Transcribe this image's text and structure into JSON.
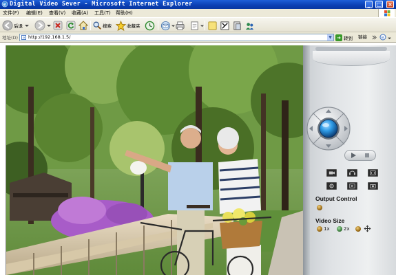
{
  "window": {
    "title": "Digital Video Sever - Microsoft Internet Explorer",
    "buttons": {
      "minimize": "_",
      "maximize": "□",
      "close": "×"
    }
  },
  "menu": {
    "items": [
      "文件(F)",
      "编辑(E)",
      "查看(V)",
      "收藏(A)",
      "工具(T)",
      "帮助(H)"
    ]
  },
  "toolbar": {
    "back_label": "后退",
    "search_label": "搜索",
    "favorites_label": "收藏夹"
  },
  "address": {
    "label": "地址(D)",
    "url": "http://192.168.1.5/",
    "go_label": "转到",
    "links_label": "链接"
  },
  "panel": {
    "output_control_title": "Output Control",
    "video_size_title": "Video Size",
    "size_options": [
      "1x",
      "2x"
    ],
    "selected_size": "2x"
  },
  "colors": {
    "titlebar": "#0a3fb3",
    "chrome": "#ece9d8",
    "panel": "#dfe2e5",
    "ptz_glow": "#2e9be6"
  }
}
